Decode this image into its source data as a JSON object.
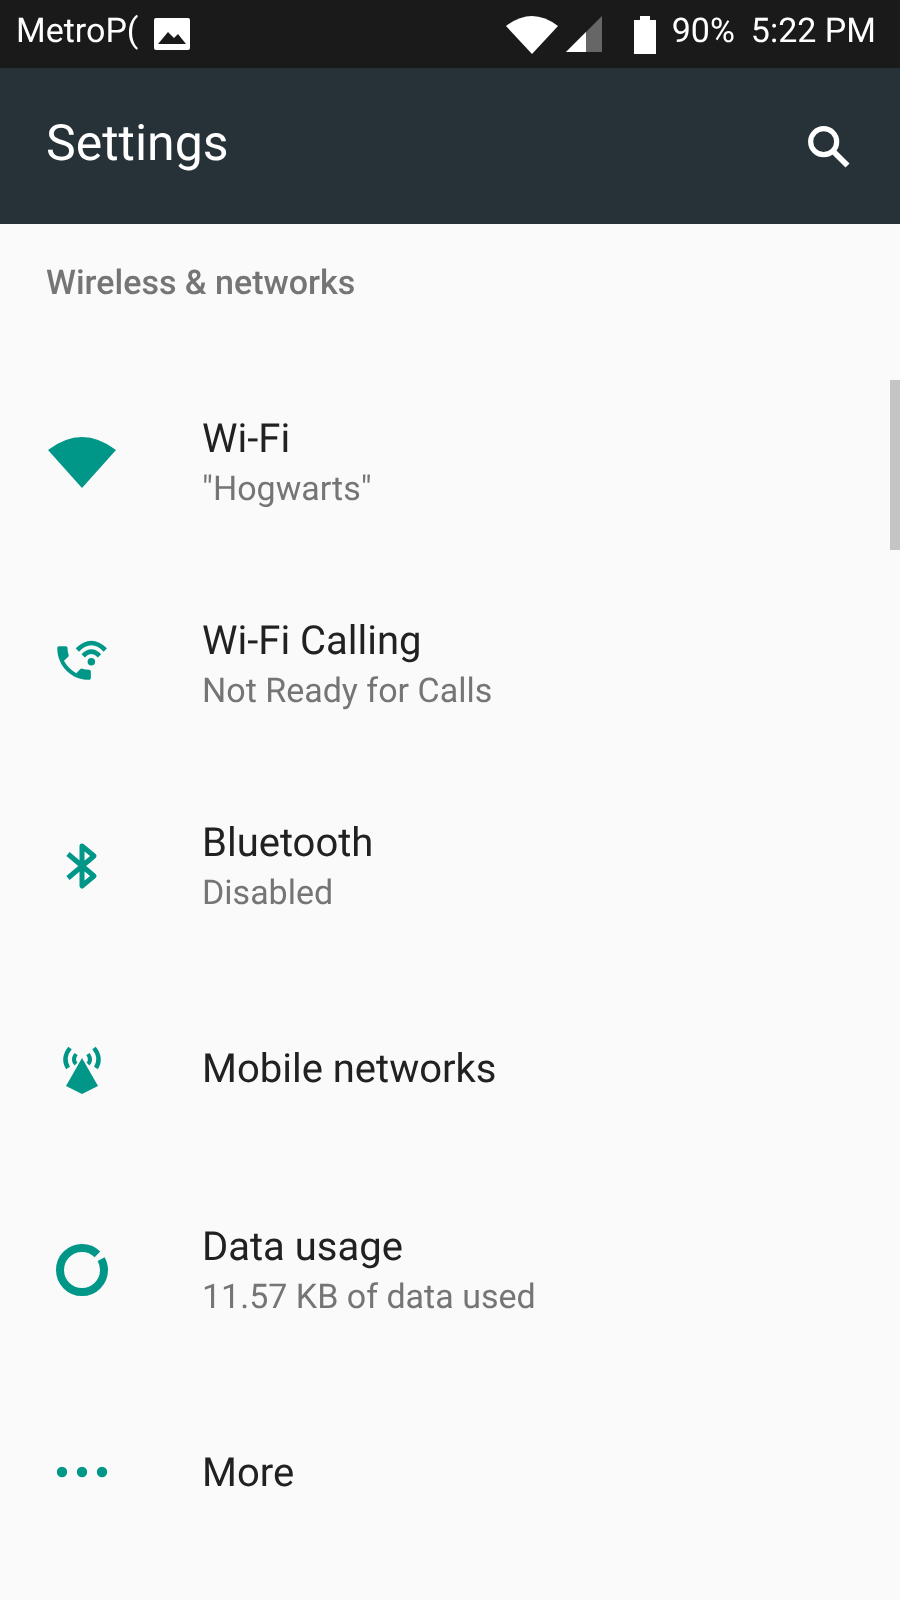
{
  "status_bar": {
    "carrier": "MetroP(",
    "battery": "90%",
    "time": "5:22 PM"
  },
  "app_bar": {
    "title": "Settings"
  },
  "section": {
    "title": "Wireless & networks"
  },
  "items": [
    {
      "kind": "wifi",
      "title": "Wi-Fi",
      "summary": "\"Hogwarts\""
    },
    {
      "kind": "wifi-calling",
      "title": "Wi-Fi Calling",
      "summary": "Not Ready for Calls"
    },
    {
      "kind": "bluetooth",
      "title": "Bluetooth",
      "summary": "Disabled"
    },
    {
      "kind": "mobile",
      "title": "Mobile networks"
    },
    {
      "kind": "data",
      "title": "Data usage",
      "summary": "11.57 KB of data used"
    },
    {
      "kind": "more",
      "title": "More"
    }
  ]
}
